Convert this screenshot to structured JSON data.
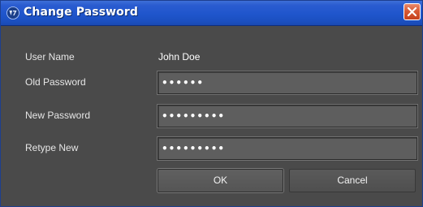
{
  "window": {
    "title": "Change Password",
    "icon": "app-logo-icon",
    "close_icon": "close-icon",
    "accent": "#1f55cc"
  },
  "form": {
    "user_name_label": "User Name",
    "user_name_value": "John Doe",
    "old_password_label": "Old Password",
    "old_password_value": "••••••",
    "new_password_label": "New Password",
    "new_password_value": "•••••••••",
    "retype_new_label": "Retype New",
    "retype_new_value": "•••••••••"
  },
  "buttons": {
    "ok_label": "OK",
    "cancel_label": "Cancel"
  }
}
